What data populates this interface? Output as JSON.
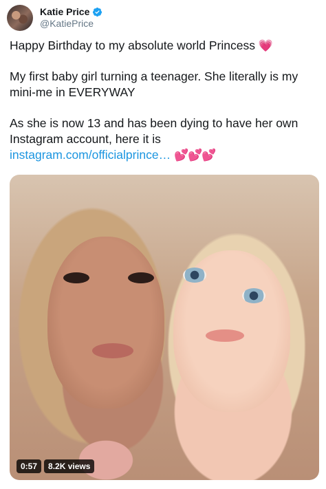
{
  "header": {
    "display_name": "Katie Price",
    "handle": "@KatiePrice",
    "verified_icon": "verified-badge-icon",
    "avatar_icon": "avatar-photo"
  },
  "tweet": {
    "line1": "Happy Birthday to my absolute world Princess",
    "line1_emoji": "💗",
    "para2": "My first baby girl turning a teenager. She literally is my mini-me in EVERYWAY",
    "para3": "As she is now 13 and has been dying to have her own Instagram account, here it is",
    "link": "instagram.com/officialprince…",
    "trailing_emojis": "💕💕💕"
  },
  "media": {
    "duration": "0:57",
    "views": "8.2K views"
  },
  "colors": {
    "link": "#1b95e0",
    "verified": "#1da1f2",
    "text": "#14171a",
    "secondary": "#657786"
  }
}
